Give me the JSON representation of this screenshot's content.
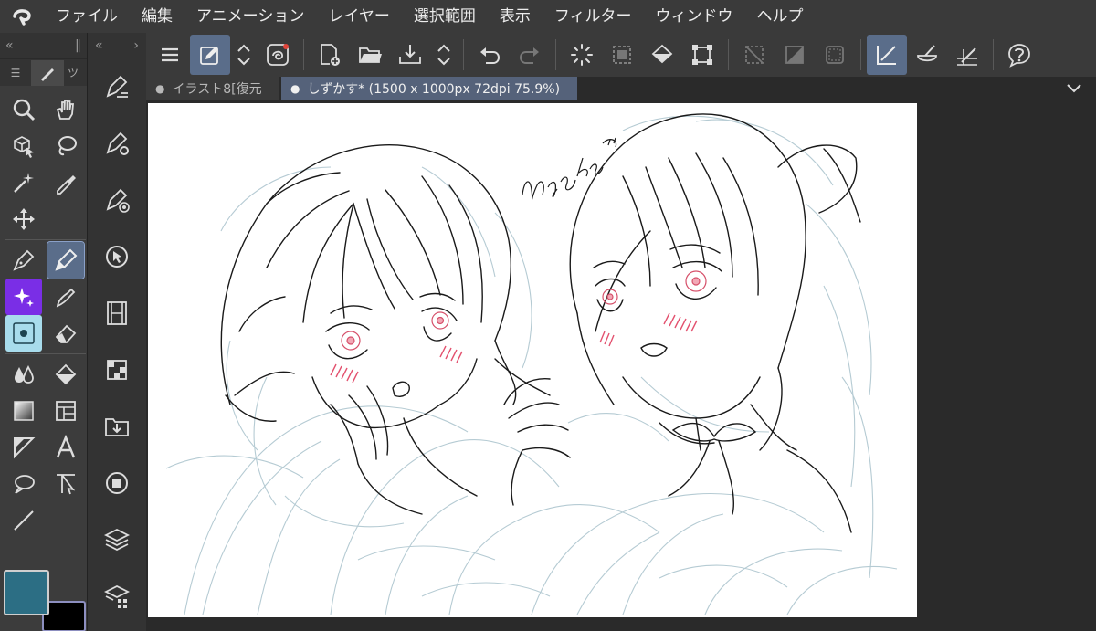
{
  "menu": {
    "items": [
      "ファイル",
      "編集",
      "アニメーション",
      "レイヤー",
      "選択範囲",
      "表示",
      "フィルター",
      "ウィンドウ",
      "ヘルプ"
    ]
  },
  "tabs": {
    "tab1_label": "イラスト8[復元",
    "tab2_label": "しずかす* (1500 x 1000px 72dpi 75.9%)",
    "dot": "●"
  },
  "toolpanel": {
    "collapse_left": "«",
    "grip": "‖",
    "menu_icon": "☰",
    "tab_label": "ツ"
  },
  "panelcol": {
    "collapse": "«",
    "expand": "›"
  },
  "canvas": {
    "signature": "nyako",
    "line_color": "#1a1a1a",
    "sketch_color": "#a9c2cc",
    "blush_color": "#e04060"
  },
  "colors": {
    "main": "#2c6e84",
    "sub": "#000000",
    "accent": "#5a6d8a"
  }
}
